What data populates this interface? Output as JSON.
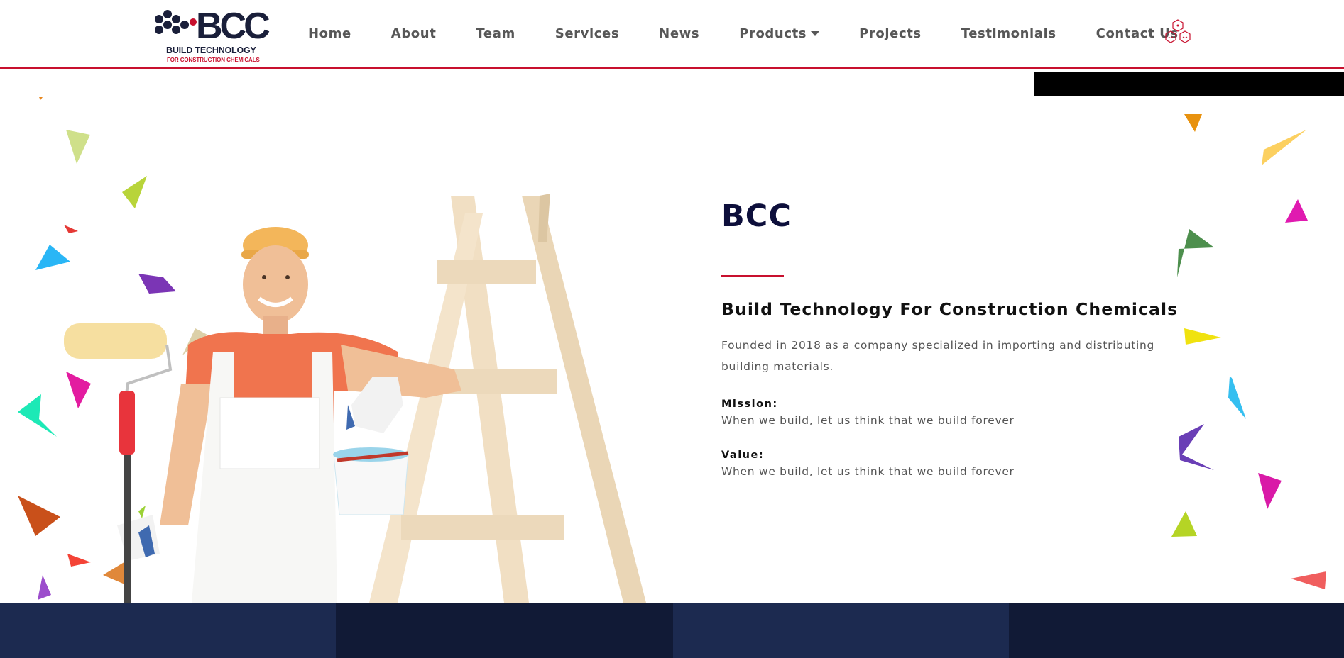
{
  "brand": {
    "logo_text": "BCC",
    "tagline_main": "BUILD TECHNOLOGY",
    "tagline_sub": "FOR CONSTRUCTION CHEMICALS",
    "navy": "#1a1f3a",
    "red": "#c8102e"
  },
  "nav": {
    "items": [
      {
        "label": "Home"
      },
      {
        "label": "About"
      },
      {
        "label": "Team"
      },
      {
        "label": "Services"
      },
      {
        "label": "News"
      },
      {
        "label": "Products",
        "has_dropdown": true
      },
      {
        "label": "Projects"
      },
      {
        "label": "Testimonials"
      },
      {
        "label": "Contact Us"
      }
    ],
    "extra_icon": "hexagon-cluster-icon"
  },
  "about": {
    "title": "BCC",
    "subtitle": "Build Technology For Construction Chemicals",
    "description": "Founded in 2018 as a company specialized in importing and distributing building materials.",
    "mission_label": "Mission:",
    "mission_text": "When we build, let us think that we build forever",
    "value_label": "Value:",
    "value_text": "When we build, let us think that we build forever"
  },
  "hero_image": {
    "subject": "painter-with-ladder-illustration"
  },
  "footer_colors": [
    "#1c2a50",
    "#111a36",
    "#1c2a50",
    "#111a36"
  ]
}
